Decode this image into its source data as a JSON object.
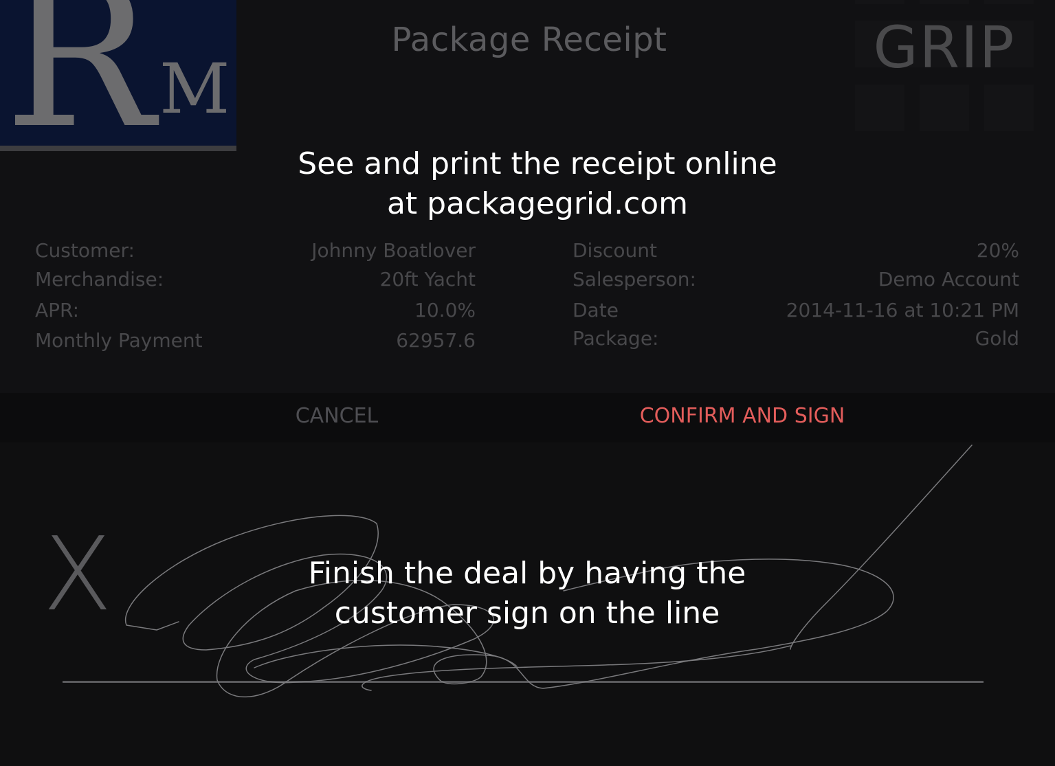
{
  "header": {
    "title": "Package Receipt",
    "brand_word": "GRIP",
    "logo_letters": [
      "R",
      "M"
    ]
  },
  "tips": {
    "receipt_online": [
      "See and print the receipt online",
      "at packagegrid.com"
    ],
    "sign_instruction": [
      "Finish the deal by having the",
      "customer sign on the line"
    ]
  },
  "receipt": {
    "left": [
      {
        "label": "Customer:",
        "value": "Johnny Boatlover"
      },
      {
        "label": "Merchandise:",
        "value": "20ft Yacht"
      },
      {
        "label": "APR:",
        "value": "10.0%"
      },
      {
        "label": "Monthly Payment",
        "value": "62957.6"
      }
    ],
    "right": [
      {
        "label": "Discount",
        "value": "20%"
      },
      {
        "label": "Salesperson:",
        "value": "Demo Account"
      },
      {
        "label": "Date",
        "value": "2014-11-16 at 10:21 PM"
      },
      {
        "label": "Package:",
        "value": "Gold"
      }
    ]
  },
  "actions": {
    "cancel_label": "CANCEL",
    "confirm_label": "CONFIRM AND SIGN"
  },
  "signature": {
    "mark": "X"
  },
  "colors": {
    "accent": "#e35d5b",
    "background": "#0f0f10",
    "dim_text": "#48484b",
    "highlight_text": "#ffffff",
    "logo_bg": "#0a1430"
  }
}
